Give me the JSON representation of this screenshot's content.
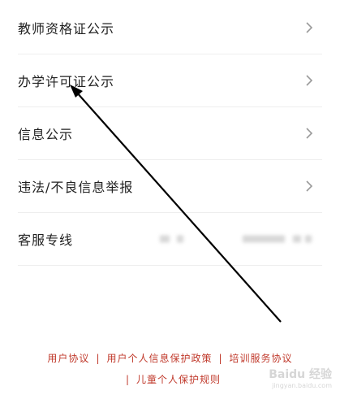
{
  "menu": {
    "items": [
      {
        "label": "教师资格证公示",
        "has_chevron": true
      },
      {
        "label": "办学许可证公示",
        "has_chevron": true
      },
      {
        "label": "信息公示",
        "has_chevron": true
      },
      {
        "label": "违法/不良信息举报",
        "has_chevron": true
      },
      {
        "label": "客服专线",
        "has_chevron": false,
        "value": ""
      }
    ]
  },
  "footer": {
    "links": [
      "用户协议",
      "用户个人信息保护政策",
      "培训服务协议",
      "儿童个人保护规则"
    ],
    "separator": "|"
  },
  "watermark": {
    "text": "Baidu 经验",
    "url": "jingyan.baidu.com"
  },
  "colors": {
    "footer_link": "#c0392b",
    "text": "#222222",
    "divider": "#eeeeee",
    "chevron": "#999999",
    "arrow": "#000000"
  },
  "icons": {
    "chevron": "chevron-right-icon"
  }
}
